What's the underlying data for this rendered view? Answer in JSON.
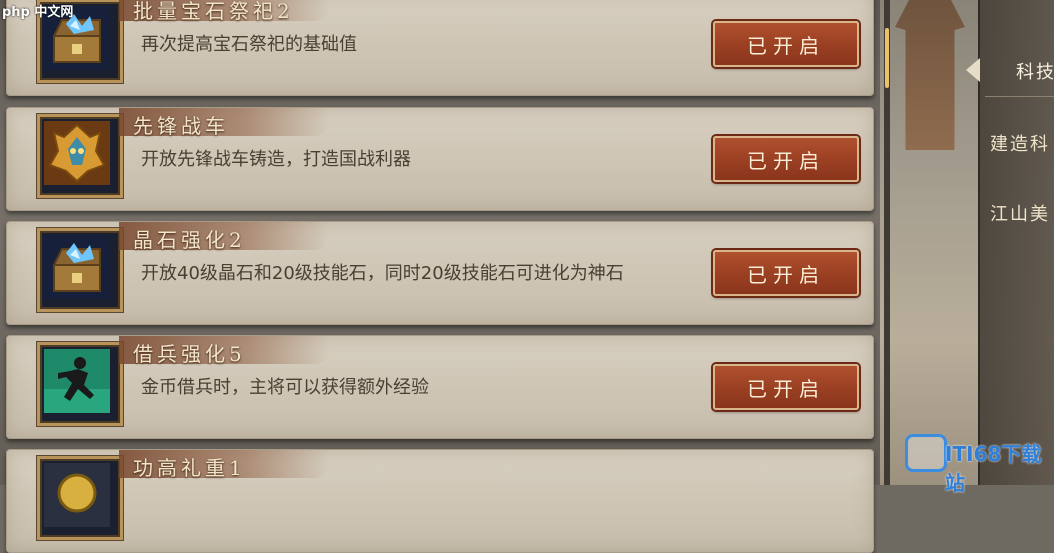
{
  "watermark_top_left": "php 中文网",
  "watermark_bottom_right": "ITI68下载站",
  "cards": [
    {
      "title": "批量宝石祭祀2",
      "desc": "再次提高宝石祭祀的基础值",
      "button": "已开启",
      "icon": "gem-chest-icon"
    },
    {
      "title": "先锋战车",
      "desc": "开放先锋战车铸造，打造国战利器",
      "button": "已开启",
      "icon": "dragon-helmet-icon"
    },
    {
      "title": "晶石强化2",
      "desc": "开放40级晶石和20级技能石，同时20级技能石可进化为神石",
      "button": "已开启",
      "icon": "gem-chest-icon"
    },
    {
      "title": "借兵强化5",
      "desc": "金币借兵时，主将可以获得额外经验",
      "button": "已开启",
      "icon": "running-soldier-icon"
    },
    {
      "title": "功高礼重1",
      "desc": "",
      "button": "",
      "icon": "medal-icon"
    }
  ],
  "side_tabs": [
    {
      "label": "科技",
      "active": true
    },
    {
      "label": "建造科",
      "active": false
    },
    {
      "label": "江山美",
      "active": false
    }
  ],
  "colors": {
    "button_red": "#9a3f22",
    "card_parchment": "#d8d0c2",
    "title_ribbon": "#7a4630",
    "accent_gold": "#e9c26a"
  }
}
